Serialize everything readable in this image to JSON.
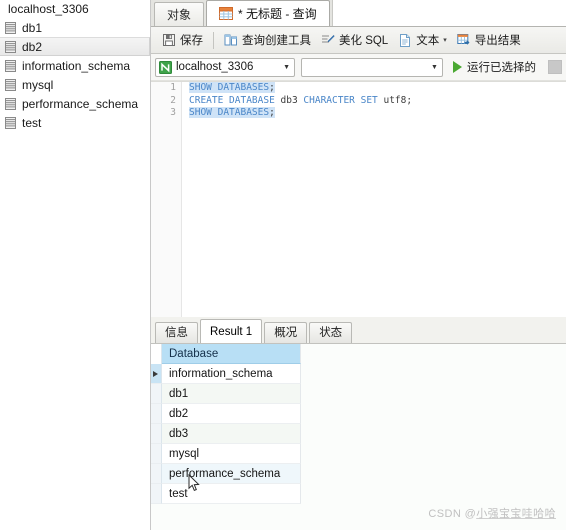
{
  "sidebar": {
    "root_label": "localhost_3306",
    "items": [
      {
        "label": "db1",
        "icon": "database-icon",
        "selected": false
      },
      {
        "label": "db2",
        "icon": "database-icon",
        "selected": true
      },
      {
        "label": "information_schema",
        "icon": "database-icon",
        "selected": false
      },
      {
        "label": "mysql",
        "icon": "database-icon",
        "selected": false
      },
      {
        "label": "performance_schema",
        "icon": "database-icon",
        "selected": false
      },
      {
        "label": "test",
        "icon": "database-icon",
        "selected": false
      }
    ]
  },
  "tabs": {
    "objects": "对象",
    "query": "* 无标题 - 查询",
    "query_icon": "query-table-icon"
  },
  "toolbar": {
    "save": "保存",
    "save_icon": "save-disk-icon",
    "query_builder": "查询创建工具",
    "query_builder_icon": "query-builder-icon",
    "beautify_sql": "美化 SQL",
    "beautify_icon": "beautify-pen-icon",
    "text": "文本",
    "text_icon": "text-document-icon",
    "text_caret": "▾",
    "export": "导出结果",
    "export_icon": "export-grid-icon"
  },
  "connbar": {
    "connection": "localhost_3306",
    "connection_icon": "navicat-connection-icon",
    "database": "",
    "dropdown_arrow": "▼",
    "run_selected": "运行已选择的",
    "run_icon": "play-triangle-icon",
    "stop_icon": "stop-square-icon"
  },
  "editor": {
    "line_numbers": [
      "1",
      "2",
      "3"
    ],
    "lines": [
      {
        "selected": true,
        "tokens": [
          {
            "t": "SHOW DATABASES",
            "k": "kw"
          },
          {
            "t": ";",
            "k": "idn"
          }
        ]
      },
      {
        "selected": false,
        "tokens": [
          {
            "t": "CREATE DATABASE ",
            "k": "kw"
          },
          {
            "t": "db3 ",
            "k": "idn"
          },
          {
            "t": "CHARACTER SET ",
            "k": "kw"
          },
          {
            "t": "utf8;",
            "k": "idn"
          }
        ]
      },
      {
        "selected": true,
        "tokens": [
          {
            "t": "SHOW DATABASES",
            "k": "kw"
          },
          {
            "t": ";",
            "k": "idn"
          }
        ]
      }
    ]
  },
  "result_tabs": [
    {
      "label": "信息",
      "active": false
    },
    {
      "label": "Result 1",
      "active": true
    },
    {
      "label": "概况",
      "active": false
    },
    {
      "label": "状态",
      "active": false
    }
  ],
  "grid": {
    "columns": [
      "Database"
    ],
    "current_row": 0,
    "rows": [
      [
        "information_schema"
      ],
      [
        "db1"
      ],
      [
        "db2"
      ],
      [
        "db3"
      ],
      [
        "mysql"
      ],
      [
        "performance_schema"
      ],
      [
        "test"
      ]
    ]
  },
  "watermark": {
    "prefix": "CSDN @",
    "user": "小强宝宝哇哈哈"
  },
  "colors": {
    "keyword": "#4a86c8",
    "selection": "#cfe3f7",
    "grid_header": "#b8dff5",
    "run_green": "#4aa832"
  }
}
